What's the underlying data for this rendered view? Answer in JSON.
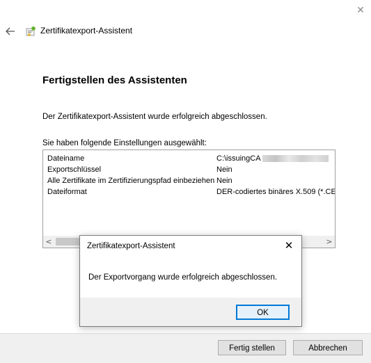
{
  "wizard": {
    "title": "Zertifikatexport-Assistent",
    "close_glyph": "✕",
    "heading": "Fertigstellen des Assistenten",
    "description": "Der Zertifikatexport-Assistent wurde erfolgreich abgeschlossen.",
    "settings_label": "Sie haben folgende Einstellungen ausgewählt:",
    "settings": [
      {
        "key": "Dateiname",
        "value": "C:\\issuingCA"
      },
      {
        "key": "Exportschlüssel",
        "value": "Nein"
      },
      {
        "key": "Alle Zertifikate im Zertifizierungspfad einbeziehen",
        "value": "Nein"
      },
      {
        "key": "Dateiformat",
        "value": "DER-codiertes binäres X.509 (*.CE"
      }
    ],
    "scroll_left": "<",
    "scroll_right": ">",
    "buttons": {
      "finish": "Fertig stellen",
      "cancel": "Abbrechen"
    }
  },
  "dialog": {
    "title": "Zertifikatexport-Assistent",
    "close_glyph": "✕",
    "message": "Der Exportvorgang wurde erfolgreich abgeschlossen.",
    "ok_label": "OK"
  },
  "colors": {
    "accent": "#0078d7",
    "footer_bg": "#f0f0f0",
    "button_bg": "#e1e1e1"
  }
}
